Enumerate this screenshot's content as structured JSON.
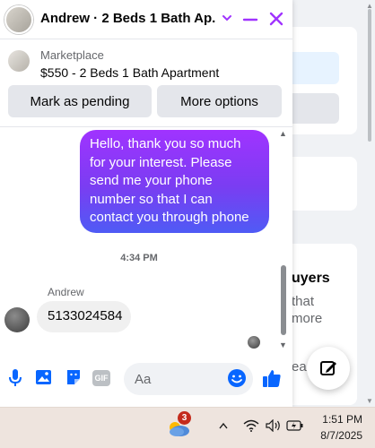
{
  "background": {
    "heading": "uyers",
    "line1": "that",
    "line2": "more",
    "line3": "ear"
  },
  "chat": {
    "title": "Andrew · 2 Beds 1 Bath Ap...",
    "marketplace_label": "Marketplace",
    "listing_title": "$550 - 2 Beds 1 Bath Apartment",
    "mark_pending_label": "Mark as pending",
    "more_options_label": "More options",
    "outgoing_lines": [
      "Hello, thank you so much",
      "for your interest. Please",
      "send me your phone",
      "number so that I can",
      "contact you through phone"
    ],
    "timestamp": "4:34 PM",
    "sender_name": "Andrew",
    "incoming_message": "5133024584",
    "input_placeholder": "Aa",
    "gif_label": "GIF"
  },
  "taskbar": {
    "notification_count": "3",
    "time": "1:51 PM",
    "date": "8/7/2025"
  },
  "colors": {
    "accent": "#a033ff",
    "messenger_blue": "#0866ff",
    "bubble_gradient_top": "#a033ff",
    "bubble_gradient_bottom": "#4f5bf5"
  }
}
